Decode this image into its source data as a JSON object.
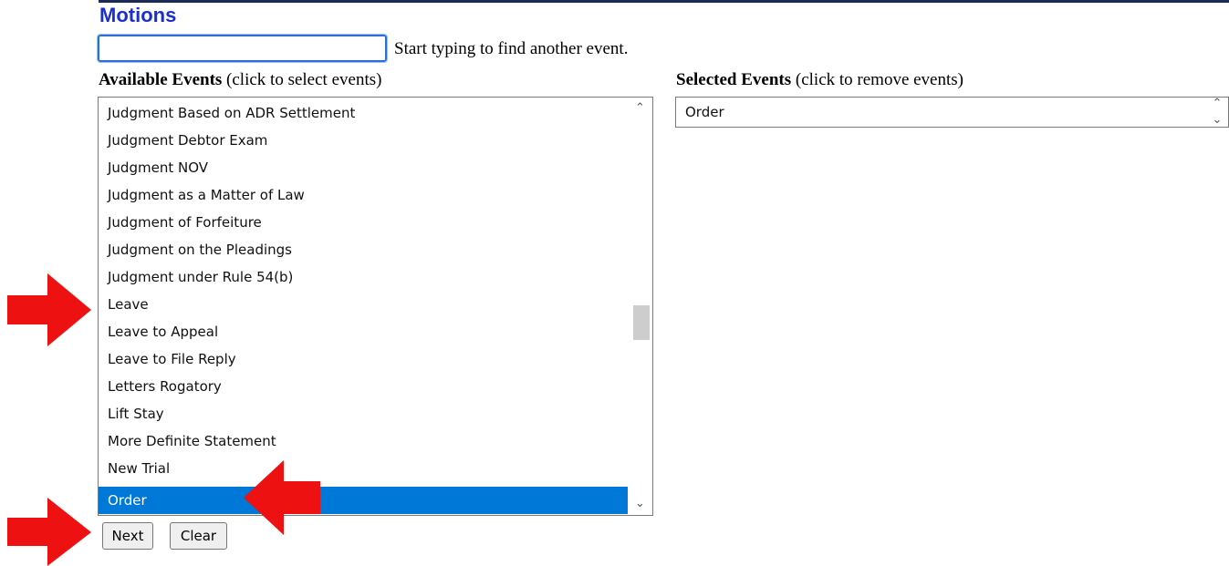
{
  "title": "Motions",
  "search": {
    "value": "",
    "placeholder": ""
  },
  "hint": "Start typing to find another event.",
  "available": {
    "header_bold": "Available Events",
    "header_rest": " (click to select events)",
    "items": [
      "Judgment Based on ADR Settlement",
      "Judgment Debtor Exam",
      "Judgment NOV",
      "Judgment as a Matter of Law",
      "Judgment of Forfeiture",
      "Judgment on the Pleadings",
      "Judgment under Rule 54(b)",
      "Leave",
      "Leave to Appeal",
      "Leave to File Reply",
      "Letters Rogatory",
      "Lift Stay",
      "More Definite Statement",
      "New Trial",
      "Order"
    ],
    "selected_item": "Order"
  },
  "selected": {
    "header_bold": "Selected Events",
    "header_rest": " (click to remove events)",
    "items": [
      "Order"
    ]
  },
  "buttons": {
    "next": "Next",
    "clear": "Clear"
  },
  "icons": {
    "scroll_up": "chevron-up-icon",
    "scroll_down": "chevron-down-icon",
    "annotation": "red-arrow-icon"
  },
  "colors": {
    "title": "#1b2fd1",
    "selection": "#0078d7",
    "annotation_arrow": "#ee1111"
  }
}
